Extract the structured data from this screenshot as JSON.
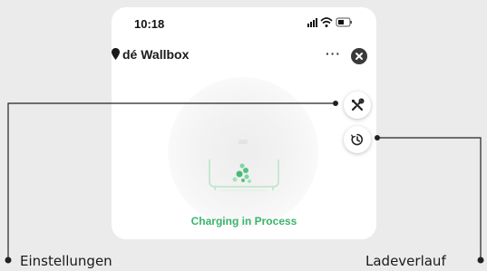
{
  "status_bar": {
    "time": "10:18"
  },
  "header": {
    "title": "dé Wallbox",
    "more_label": "···"
  },
  "main": {
    "status_text": "Charging in Process",
    "accent_color": "#3ab56a"
  },
  "icons": {
    "settings": "tools-icon",
    "history": "clock-history-icon",
    "close": "close-icon",
    "location": "location-pin-icon",
    "more": "more-horizontal-icon"
  },
  "callouts": {
    "settings_label": "Einstellungen",
    "history_label": "Ladeverlauf"
  }
}
